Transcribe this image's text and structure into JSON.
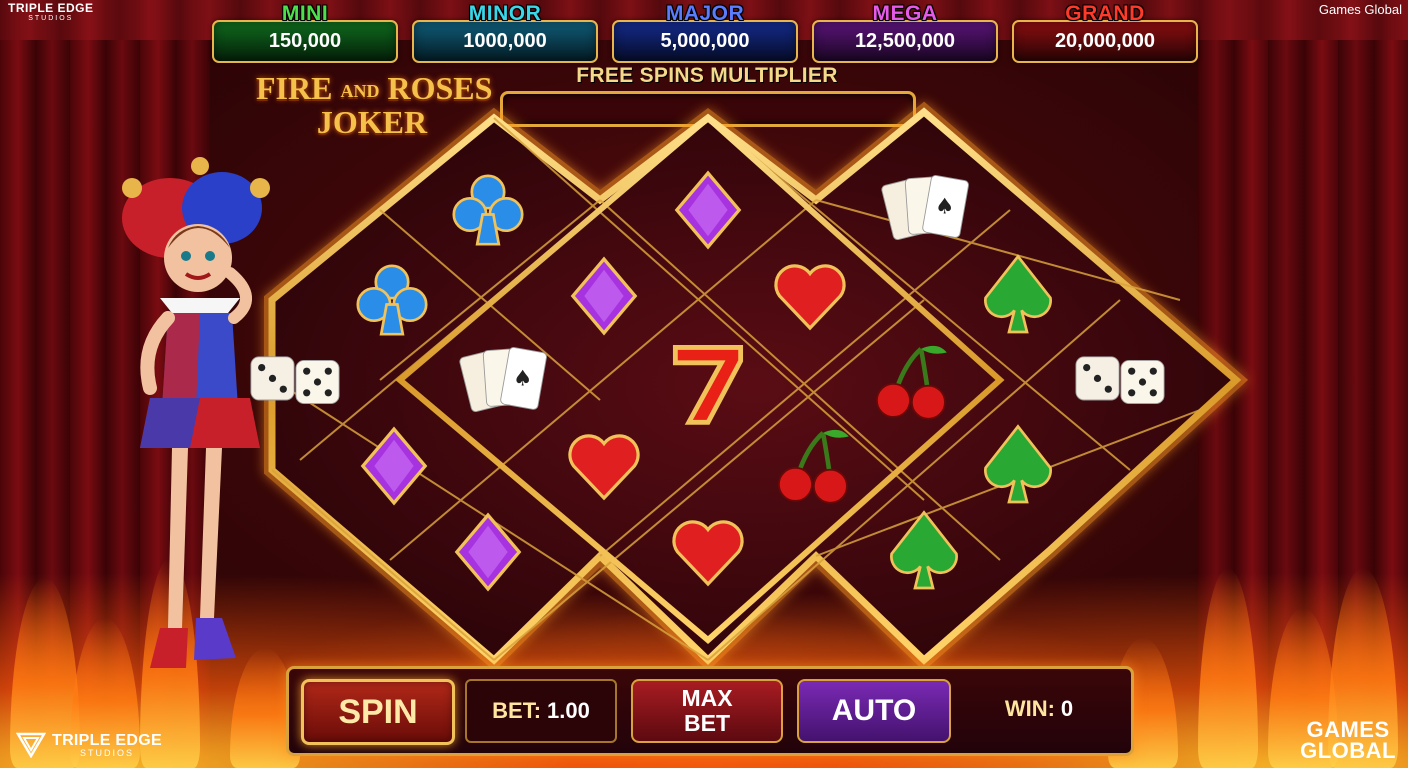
{
  "brand": {
    "top_left_line1": "TRIPLE EDGE",
    "top_left_line2": "STUDIOS",
    "top_right": "Games Global",
    "bottom_left_line1": "TRIPLE EDGE",
    "bottom_left_line2": "STUDIOS",
    "bottom_right_line1": "GAMES",
    "bottom_right_line2": "GLOBAL"
  },
  "jackpots": [
    {
      "name": "MINI",
      "value": "150,000",
      "name_color": "#4ee04a",
      "box_color": "#0f6a1e"
    },
    {
      "name": "MINOR",
      "value": "1000,000",
      "name_color": "#3ad7e8",
      "box_color": "#0f5c78"
    },
    {
      "name": "MAJOR",
      "value": "5,000,000",
      "name_color": "#5a7cff",
      "box_color": "#142a8a"
    },
    {
      "name": "MEGA",
      "value": "12,500,000",
      "name_color": "#e65ae8",
      "box_color": "#5a1478"
    },
    {
      "name": "GRAND",
      "value": "20,000,000",
      "name_color": "#ff3a2a",
      "box_color": "#8a0e10"
    }
  ],
  "game_title": {
    "line1_a": "FIRE",
    "line1_and": "AND",
    "line1_b": "ROSES",
    "line2": "JOKER"
  },
  "free_spins": {
    "label": "FREE SPINS MULTIPLIER"
  },
  "controls": {
    "spin": "SPIN",
    "bet_label": "BET:",
    "bet_value": "1.00",
    "max_bet_line1": "MAX",
    "max_bet_line2": "BET",
    "auto": "AUTO",
    "win_label": "WIN:",
    "win_value": "0"
  },
  "reels": {
    "symbols": [
      "club-icon",
      "diamond-icon",
      "cards-icon",
      "club-icon",
      "diamond-icon",
      "heart-icon",
      "spade-icon",
      "dice-icon",
      "cards-icon",
      "seven-icon",
      "cherry-icon",
      "dice-icon",
      "diamond-icon",
      "heart-icon",
      "cherry-icon",
      "spade-icon",
      "diamond-icon",
      "heart-icon",
      "spade-icon"
    ]
  },
  "colors": {
    "gold": "#e8b54a",
    "club": "#2a8ee8",
    "diamond": "#a632e0",
    "heart": "#e02020",
    "spade": "#2aa834",
    "seven": "#e82016"
  }
}
